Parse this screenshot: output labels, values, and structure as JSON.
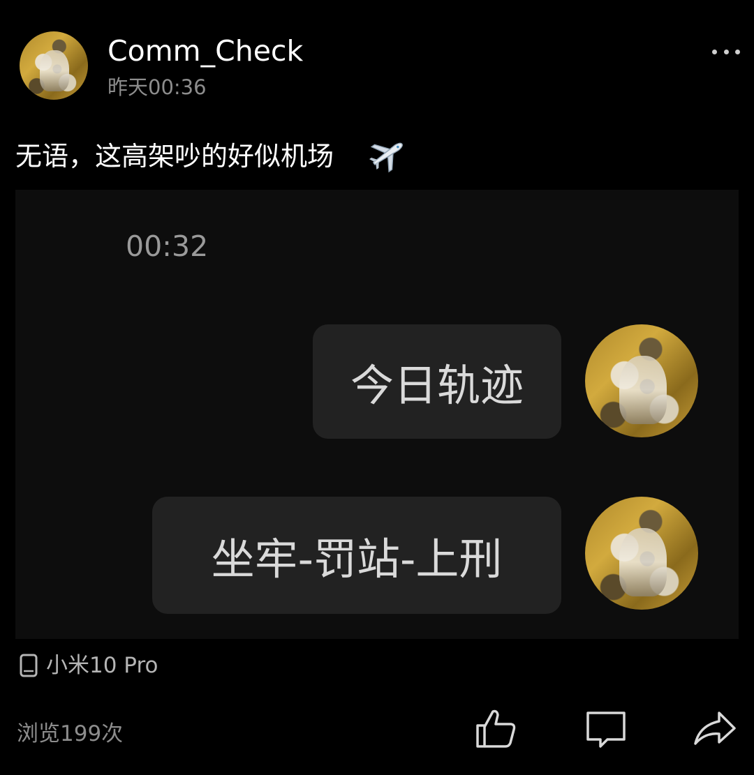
{
  "header": {
    "username": "Comm_Check",
    "time": "昨天00:36"
  },
  "post": {
    "text": "无语，这高架吵的好似机场",
    "emoji_icon": "airplane-icon"
  },
  "attachment": {
    "chat_time": "00:32",
    "messages": [
      {
        "text": "今日轨迹"
      },
      {
        "text": "坐牢-罚站-上刑"
      }
    ]
  },
  "device": {
    "icon": "phone-icon",
    "name": "小米10 Pro"
  },
  "footer": {
    "views": "浏览199次",
    "actions": [
      "thumbs-up-icon",
      "comment-icon",
      "share-icon"
    ]
  },
  "colors": {
    "background": "#000000",
    "bubble": "#222222",
    "secondary_text": "#8d8d8d"
  }
}
